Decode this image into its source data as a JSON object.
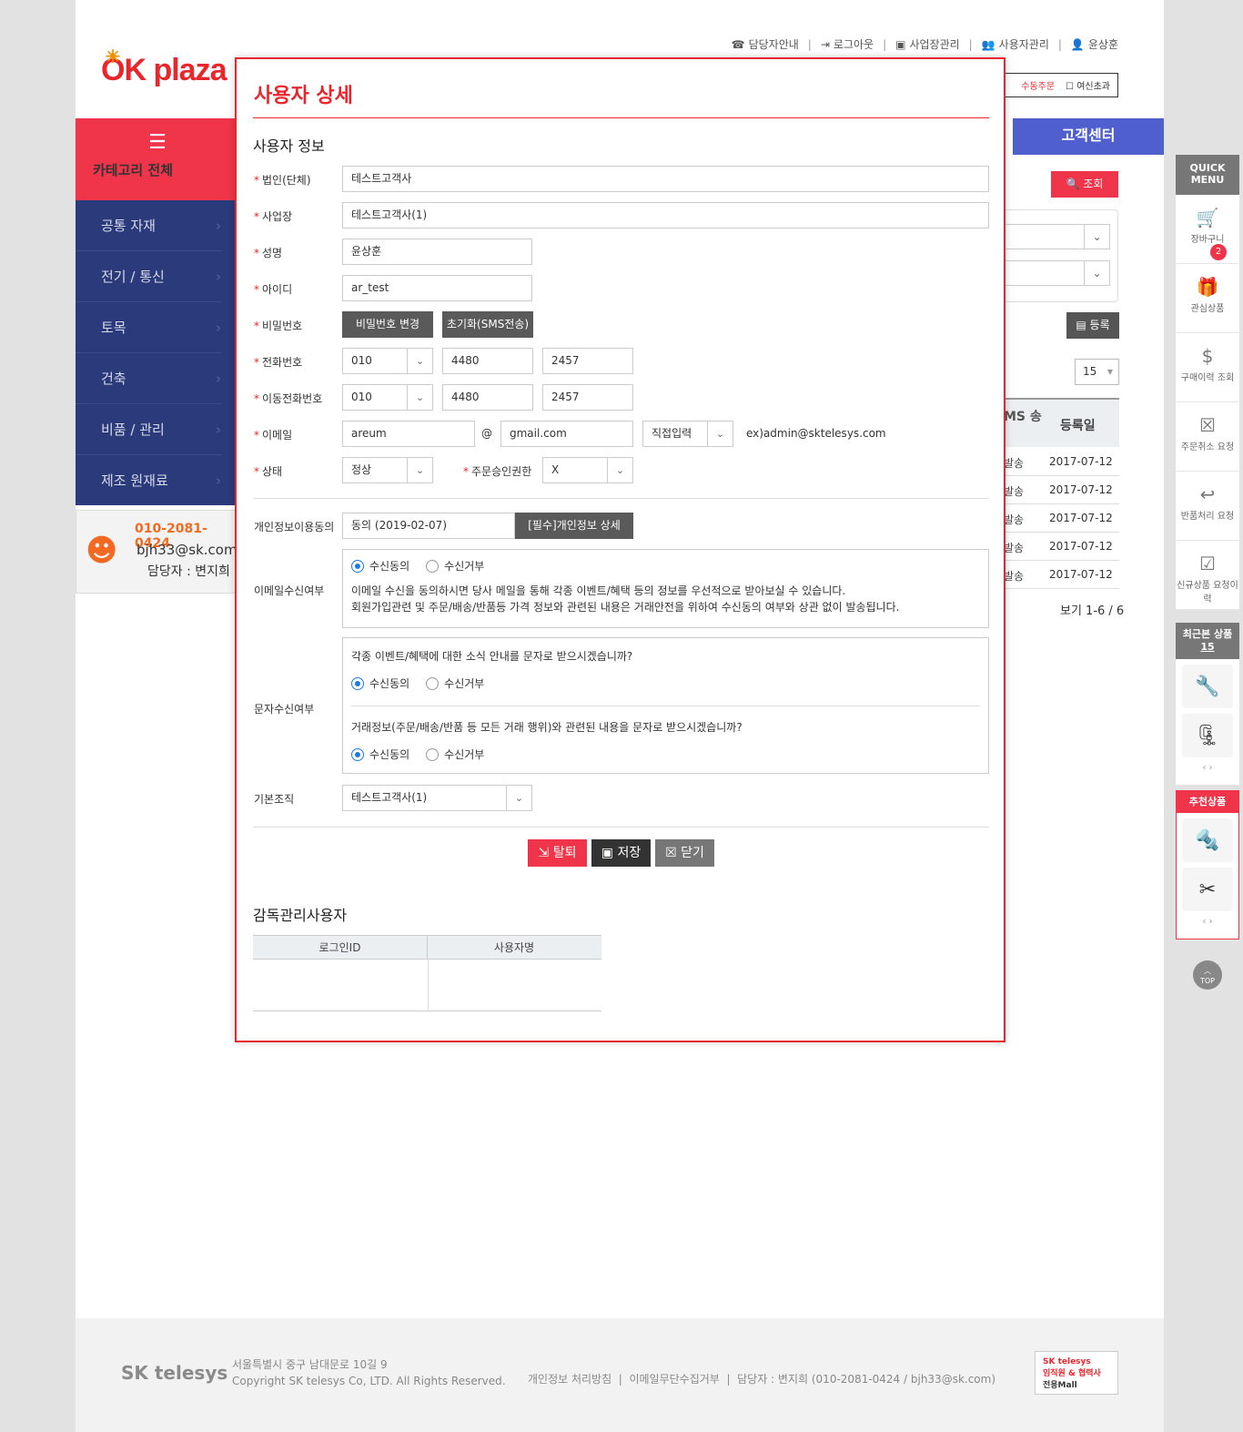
{
  "header": {
    "util_links": [
      "담당자안내",
      "로그아웃",
      "사업장관리",
      "사용자관리",
      "윤상훈"
    ],
    "logo_text": "OK plaza",
    "checks": [
      "수동주문",
      "여신초과"
    ]
  },
  "category": {
    "title": "카테고리 전체",
    "items": [
      "공통 자재",
      "전기 / 통신",
      "토목",
      "건축",
      "비품 / 관리",
      "제조 원재료"
    ]
  },
  "contact": {
    "phone": "010-2081-0424",
    "email": "bjh33@sk.com",
    "manager": "담당자 : 변지희"
  },
  "background": {
    "cs_center": "고객센터",
    "search_label": "조회",
    "register_label": "등록",
    "page_size": "15",
    "col_sms": "MS\n송",
    "col_reg": "등록일",
    "rows": [
      {
        "a": "발송",
        "b": "2017-07-12"
      },
      {
        "a": "발송",
        "b": "2017-07-12"
      },
      {
        "a": "발송",
        "b": "2017-07-12"
      },
      {
        "a": "발송",
        "b": "2017-07-12"
      },
      {
        "a": "발송",
        "b": "2017-07-12"
      }
    ],
    "paging": "보기 1-6 / 6"
  },
  "modal": {
    "title": "사용자 상세",
    "section": "사용자 정보",
    "labels": {
      "corp": "법인(단체)",
      "site": "사업장",
      "name": "성명",
      "id": "아이디",
      "pw": "비밀번호",
      "tel": "전화번호",
      "mobile": "이동전화번호",
      "email": "이메일",
      "status": "상태",
      "order_auth": "주문승인권한",
      "privacy": "개인정보이용동의",
      "email_recv": "이메일수신여부",
      "sms_recv": "문자수신여부",
      "org": "기본조직"
    },
    "values": {
      "corp": "테스트고객사",
      "site": "테스트고객사(1)",
      "name": "윤상훈",
      "id": "ar_test",
      "tel1": "010",
      "tel2": "4480",
      "tel3": "2457",
      "mob1": "010",
      "mob2": "4480",
      "mob3": "2457",
      "email_id": "areum",
      "email_at": "@",
      "email_domain": "gmail.com",
      "email_select": "직접입력",
      "email_hint": "ex)admin@sktelesys.com",
      "status": "정상",
      "order_auth": "X",
      "privacy": "동의 (2019-02-07)",
      "org": "테스트고객사(1)"
    },
    "buttons": {
      "pw_change": "비밀번호 변경",
      "pw_reset": "초기화(SMS전송)",
      "privacy_detail": "[필수]개인정보 상세",
      "withdraw": "탈퇴",
      "save": "저장",
      "close": "닫기"
    },
    "radio": {
      "agree": "수신동의",
      "deny": "수신거부"
    },
    "email_text1": "이메일 수신을 동의하시면 당사 메일을 통해 각종 이벤트/혜택 등의 정보를 우선적으로 받아보실 수 있습니다.",
    "email_text2": "회원가입관련 및 주문/배송/반품등 가격 정보와 관련된 내용은 거래안전을 위하여 수신동의 여부와 상관 없이 발송됩니다.",
    "sms_q1": "각종 이벤트/혜택에 대한 소식 안내를 문자로 받으시겠습니까?",
    "sms_q2": "거래정보(주문/배송/반품 등 모든 거래 행위)와 관련된 내용을 문자로 받으시겠습니까?",
    "section2": "감독관리사용자",
    "table_cols": [
      "로그인ID",
      "사용자명"
    ]
  },
  "quick": {
    "title": "QUICK MENU",
    "cart_count": "2",
    "items": [
      "장바구니",
      "관심상품",
      "구매이력 조회",
      "주문취소 요청",
      "반품처리 요청",
      "신규상품 요청이력"
    ],
    "recent_title": "최근본 상품",
    "recent_count": "15",
    "reco_title": "추천상품",
    "top": "TOP"
  },
  "footer": {
    "brand": "SK telesys",
    "addr1": "서울특별시 중구 남대문로 10길 9",
    "addr2": "Copyright SK telesys Co, LTD. All Rights Reserved.",
    "links": [
      "개인정보 처리방침",
      "이메일무단수집거부",
      "담당자 : 변지희 (010-2081-0424 / bjh33@sk.com)"
    ],
    "banner_line1": "SK telesys",
    "banner_line2": "임직원 & 협력사",
    "banner_line3": "전용Mall"
  }
}
